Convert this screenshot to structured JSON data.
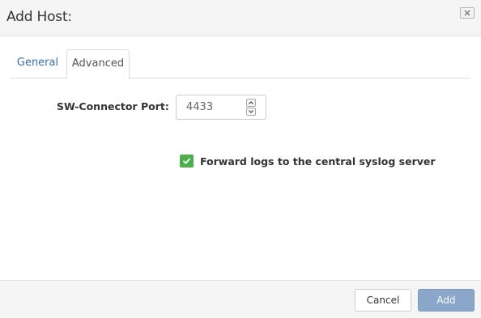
{
  "dialog": {
    "title": "Add Host:"
  },
  "tabs": [
    {
      "label": "General",
      "active": false
    },
    {
      "label": "Advanced",
      "active": true
    }
  ],
  "advanced": {
    "port_label": "SW-Connector Port:",
    "port_value": "4433",
    "forward_logs_label": "Forward logs to the central syslog server",
    "forward_logs_checked": true
  },
  "footer": {
    "cancel_label": "Cancel",
    "add_label": "Add"
  },
  "colors": {
    "checkbox": "#4cae4c",
    "add_button": "#8aa6c8",
    "active_link": "#3a6fa8"
  },
  "icons": {
    "close": "close-icon",
    "spin_up": "chevron-up-icon",
    "spin_down": "chevron-down-icon",
    "check": "check-icon"
  }
}
